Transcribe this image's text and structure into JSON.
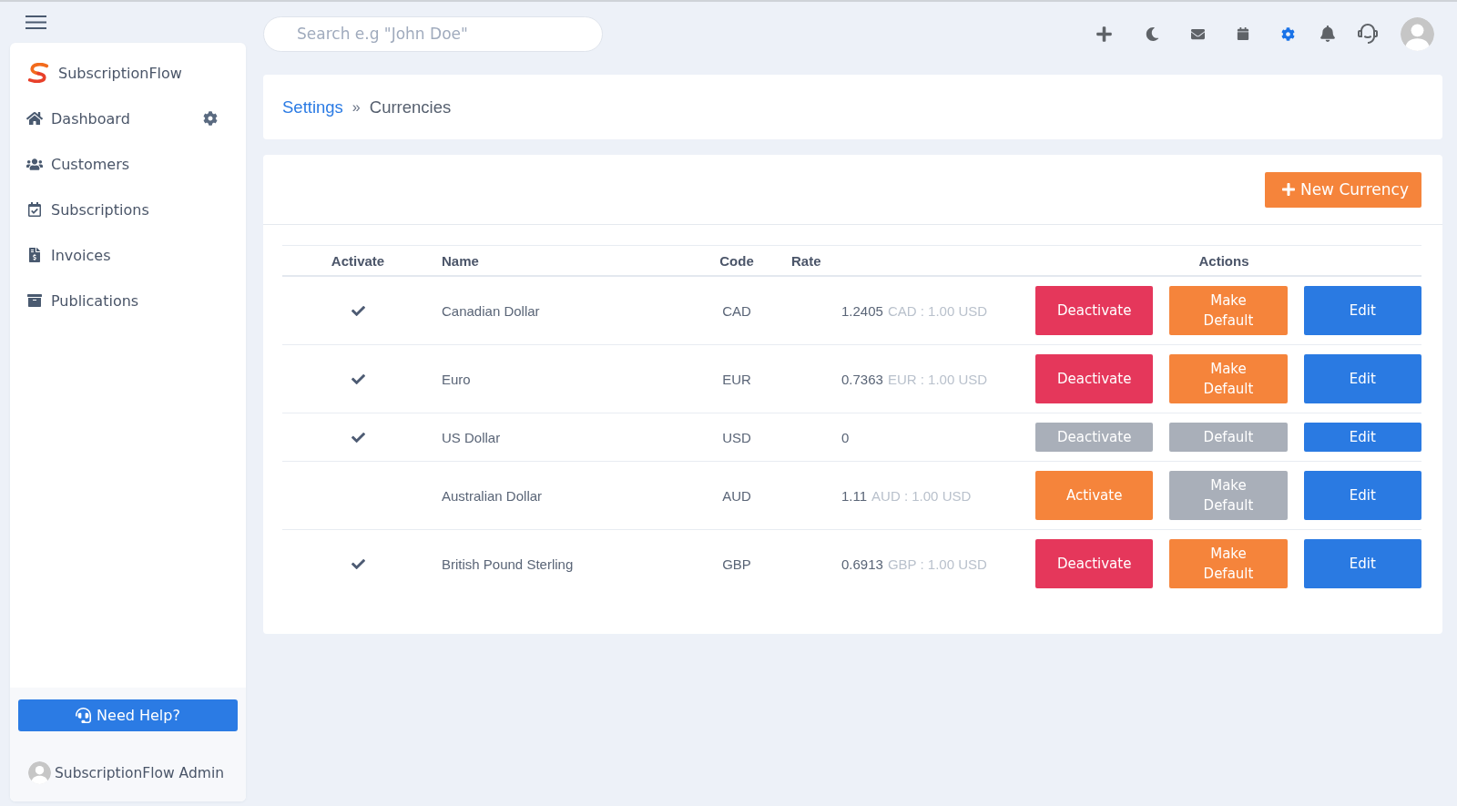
{
  "topbar": {
    "search": {
      "placeholder": "Search e.g \"John Doe\""
    },
    "toolbar": [
      {
        "selected": false
      },
      {
        "selected": false
      },
      {
        "selected": false
      },
      {
        "selected": false
      },
      {
        "selected": true
      },
      {
        "selected": false
      },
      {
        "selected": false
      }
    ]
  },
  "sidebar": {
    "brand": "SubscriptionFlow",
    "items": [
      {
        "label": "Dashboard"
      },
      {
        "label": "Customers"
      },
      {
        "label": "Subscriptions"
      },
      {
        "label": "Invoices"
      },
      {
        "label": "Publications"
      }
    ],
    "help_button": "Need Help?",
    "user": "SubscriptionFlow Admin"
  },
  "breadcrumb": [
    {
      "label": "Settings",
      "kind": "link"
    },
    {
      "label": "»",
      "kind": "separator"
    },
    {
      "label": "Currencies",
      "kind": "current"
    }
  ],
  "new_button": "New Currency",
  "table": {
    "columns": [
      "Activate",
      "Name",
      "Code",
      "Rate",
      "Actions"
    ],
    "rows": [
      {
        "active": true,
        "name": "Canadian Dollar",
        "code": "CAD",
        "rate": "1.2405",
        "rate_note": "CAD : 1.00 USD",
        "actions": [
          {
            "label": "Deactivate",
            "kind": "danger",
            "disabled": false
          },
          {
            "label": "Make Default",
            "kind": "warning",
            "disabled": false
          },
          {
            "label": "Edit",
            "kind": "primary",
            "disabled": false
          }
        ]
      },
      {
        "active": true,
        "name": "Euro",
        "code": "EUR",
        "rate": "0.7363",
        "rate_note": "EUR : 1.00 USD",
        "actions": [
          {
            "label": "Deactivate",
            "kind": "danger",
            "disabled": false
          },
          {
            "label": "Make Default",
            "kind": "warning",
            "disabled": false
          },
          {
            "label": "Edit",
            "kind": "primary",
            "disabled": false
          }
        ]
      },
      {
        "active": true,
        "name": "US Dollar",
        "code": "USD",
        "rate": "0",
        "actions": [
          {
            "label": "Deactivate",
            "kind": "danger",
            "disabled": true
          },
          {
            "label": "Default",
            "kind": "warning",
            "disabled": true
          },
          {
            "label": "Edit",
            "kind": "primary",
            "disabled": false
          }
        ]
      },
      {
        "active": false,
        "name": "Australian Dollar",
        "code": "AUD",
        "rate": "1.11",
        "rate_note": "AUD : 1.00 USD",
        "actions": [
          {
            "label": "Activate",
            "kind": "warning",
            "disabled": false
          },
          {
            "label": "Make Default",
            "kind": "warning",
            "disabled": true
          },
          {
            "label": "Edit",
            "kind": "primary",
            "disabled": false
          }
        ]
      },
      {
        "active": true,
        "name": "British Pound Sterling",
        "code": "GBP",
        "rate": "0.6913",
        "rate_note": "GBP : 1.00 USD",
        "actions": [
          {
            "label": "Deactivate",
            "kind": "danger",
            "disabled": false
          },
          {
            "label": "Make Default",
            "kind": "warning",
            "disabled": false
          },
          {
            "label": "Edit",
            "kind": "primary",
            "disabled": false
          }
        ]
      }
    ]
  }
}
